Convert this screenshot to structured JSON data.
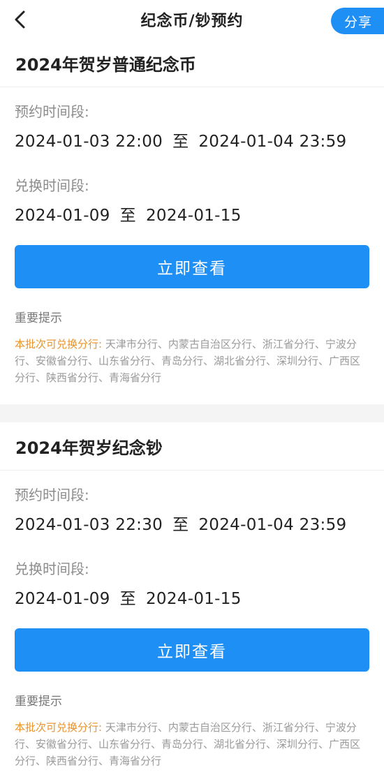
{
  "nav": {
    "title": "纪念币/钞预约",
    "share_label": "分享"
  },
  "cards": [
    {
      "title": "2024年贺岁普通纪念币",
      "reserve_label": "预约时间段:",
      "reserve_start": "2024-01-03 22:00",
      "reserve_sep": "至",
      "reserve_end": "2024-01-04 23:59",
      "exchange_label": "兑换时间段:",
      "exchange_start": "2024-01-09",
      "exchange_sep": "至",
      "exchange_end": "2024-01-15",
      "button_label": "立即查看",
      "tip_title": "重要提示",
      "tip_label": "本批次可兑换分行:",
      "tip_branches": "天津市分行、内蒙古自治区分行、浙江省分行、宁波分行、安徽省分行、山东省分行、青岛分行、湖北省分行、深圳分行、广西区分行、陕西省分行、青海省分行"
    },
    {
      "title": "2024年贺岁纪念钞",
      "reserve_label": "预约时间段:",
      "reserve_start": "2024-01-03 22:30",
      "reserve_sep": "至",
      "reserve_end": "2024-01-04 23:59",
      "exchange_label": "兑换时间段:",
      "exchange_start": "2024-01-09",
      "exchange_sep": "至",
      "exchange_end": "2024-01-15",
      "button_label": "立即查看",
      "tip_title": "重要提示",
      "tip_label": "本批次可兑换分行:",
      "tip_branches": "天津市分行、内蒙古自治区分行、浙江省分行、宁波分行、安徽省分行、山东省分行、青岛分行、湖北省分行、深圳分行、广西区分行、陕西省分行、青海省分行"
    }
  ],
  "icons": {
    "back": "chevron-left-icon"
  },
  "colors": {
    "accent": "#1e8ff5",
    "tip_label": "#e9922a",
    "label": "#8c8c8c",
    "text": "#222222"
  }
}
